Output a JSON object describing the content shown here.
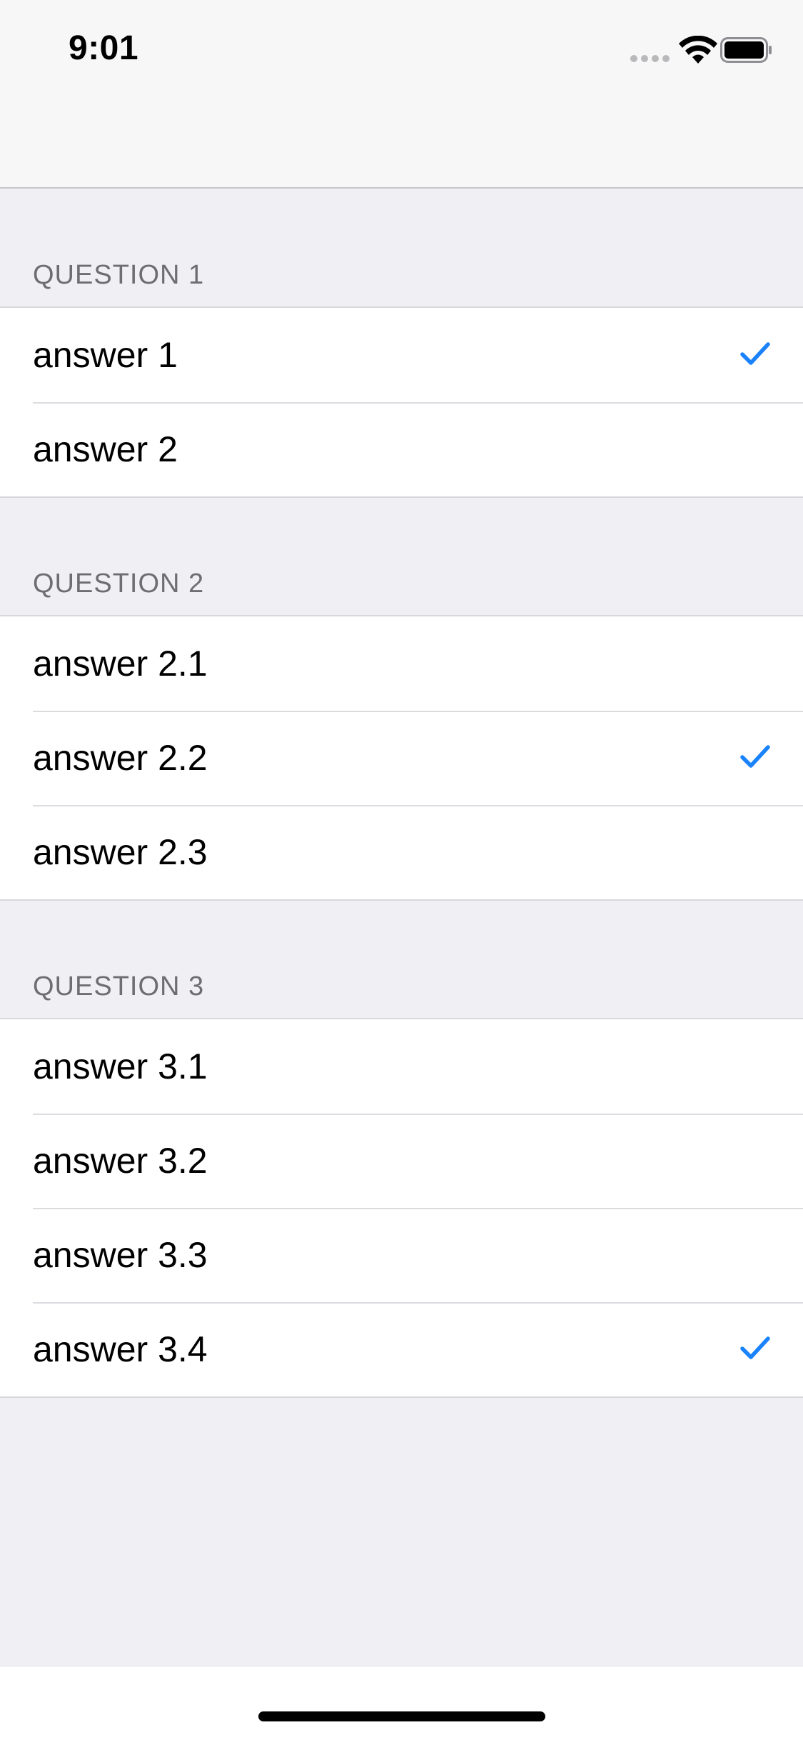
{
  "status_bar": {
    "time": "9:01",
    "icons": [
      "signal-dots-icon",
      "wifi-icon",
      "battery-icon"
    ]
  },
  "colors": {
    "accent": "#1a82fb",
    "background": "#efeff4",
    "header_text": "#6d6d72"
  },
  "sections": [
    {
      "header": "QUESTION 1",
      "answers": [
        {
          "label": "answer 1",
          "selected": true
        },
        {
          "label": "answer 2",
          "selected": false
        }
      ]
    },
    {
      "header": "QUESTION 2",
      "answers": [
        {
          "label": "answer 2.1",
          "selected": false
        },
        {
          "label": "answer 2.2",
          "selected": true
        },
        {
          "label": "answer 2.3",
          "selected": false
        }
      ]
    },
    {
      "header": "QUESTION 3",
      "answers": [
        {
          "label": "answer 3.1",
          "selected": false
        },
        {
          "label": "answer 3.2",
          "selected": false
        },
        {
          "label": "answer 3.3",
          "selected": false
        },
        {
          "label": "answer 3.4",
          "selected": true
        }
      ]
    }
  ]
}
